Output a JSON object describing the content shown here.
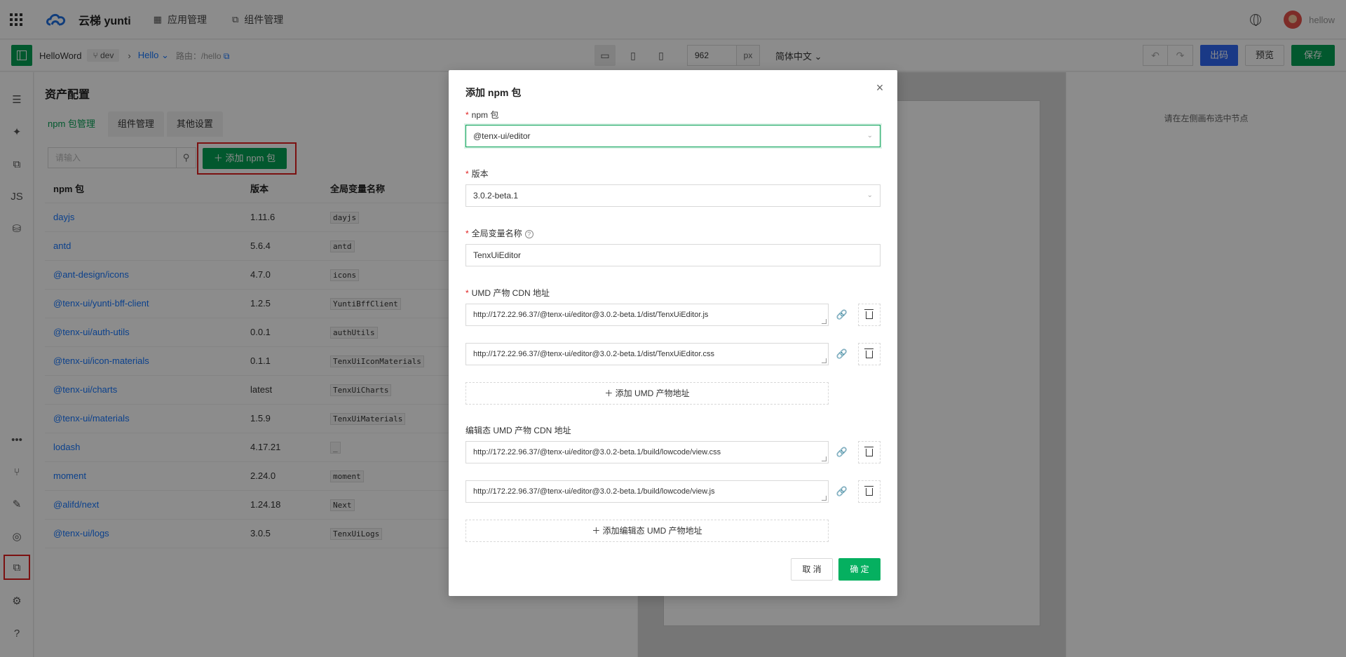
{
  "header": {
    "logo_text": "云梯 yunti",
    "nav": [
      {
        "label": "应用管理"
      },
      {
        "label": "组件管理"
      }
    ],
    "username": "hellow"
  },
  "toolbar": {
    "app_name": "HelloWord",
    "branch": "dev",
    "page": "Hello",
    "route_label": "路由：",
    "route": "/hello",
    "width_value": "962",
    "width_unit": "px",
    "language": "简体中文",
    "publish_label": "出码",
    "preview_label": "预览",
    "save_label": "保存"
  },
  "asset_panel": {
    "title": "资产配置",
    "tabs": [
      "npm 包管理",
      "组件管理",
      "其他设置"
    ],
    "search_placeholder": "请输入",
    "add_button": "添加 npm 包",
    "columns": [
      "npm 包",
      "版本",
      "全局变量名称"
    ],
    "rows": [
      {
        "name": "dayjs",
        "version": "1.11.6",
        "global": "dayjs"
      },
      {
        "name": "antd",
        "version": "5.6.4",
        "global": "antd"
      },
      {
        "name": "@ant-design/icons",
        "version": "4.7.0",
        "global": "icons"
      },
      {
        "name": "@tenx-ui/yunti-bff-client",
        "version": "1.2.5",
        "global": "YuntiBffClient"
      },
      {
        "name": "@tenx-ui/auth-utils",
        "version": "0.0.1",
        "global": "authUtils"
      },
      {
        "name": "@tenx-ui/icon-materials",
        "version": "0.1.1",
        "global": "TenxUiIconMaterials"
      },
      {
        "name": "@tenx-ui/charts",
        "version": "latest",
        "global": "TenxUiCharts"
      },
      {
        "name": "@tenx-ui/materials",
        "version": "1.5.9",
        "global": "TenxUiMaterials"
      },
      {
        "name": "lodash",
        "version": "4.17.21",
        "global": "_"
      },
      {
        "name": "moment",
        "version": "2.24.0",
        "global": "moment"
      },
      {
        "name": "@alifd/next",
        "version": "1.24.18",
        "global": "Next"
      },
      {
        "name": "@tenx-ui/logs",
        "version": "3.0.5",
        "global": "TenxUiLogs"
      }
    ]
  },
  "right_panel": {
    "hint": "请在左侧画布选中节点"
  },
  "modal": {
    "title": "添加 npm 包",
    "npm_label": "npm 包",
    "npm_value": "@tenx-ui/editor",
    "version_label": "版本",
    "version_value": "3.0.2-beta.1",
    "global_label": "全局变量名称",
    "global_value": "TenxUiEditor",
    "umd_label": "UMD 产物 CDN 地址",
    "umd_urls": [
      "http://172.22.96.37/@tenx-ui/editor@3.0.2-beta.1/dist/TenxUiEditor.js",
      "http://172.22.96.37/@tenx-ui/editor@3.0.2-beta.1/dist/TenxUiEditor.css"
    ],
    "add_umd": "添加 UMD 产物地址",
    "edit_umd_label": "编辑态 UMD 产物 CDN 地址",
    "edit_umd_urls": [
      "http://172.22.96.37/@tenx-ui/editor@3.0.2-beta.1/build/lowcode/view.css",
      "http://172.22.96.37/@tenx-ui/editor@3.0.2-beta.1/build/lowcode/view.js"
    ],
    "add_edit_umd": "添加编辑态 UMD 产物地址",
    "cancel": "取 消",
    "ok": "确 定"
  }
}
